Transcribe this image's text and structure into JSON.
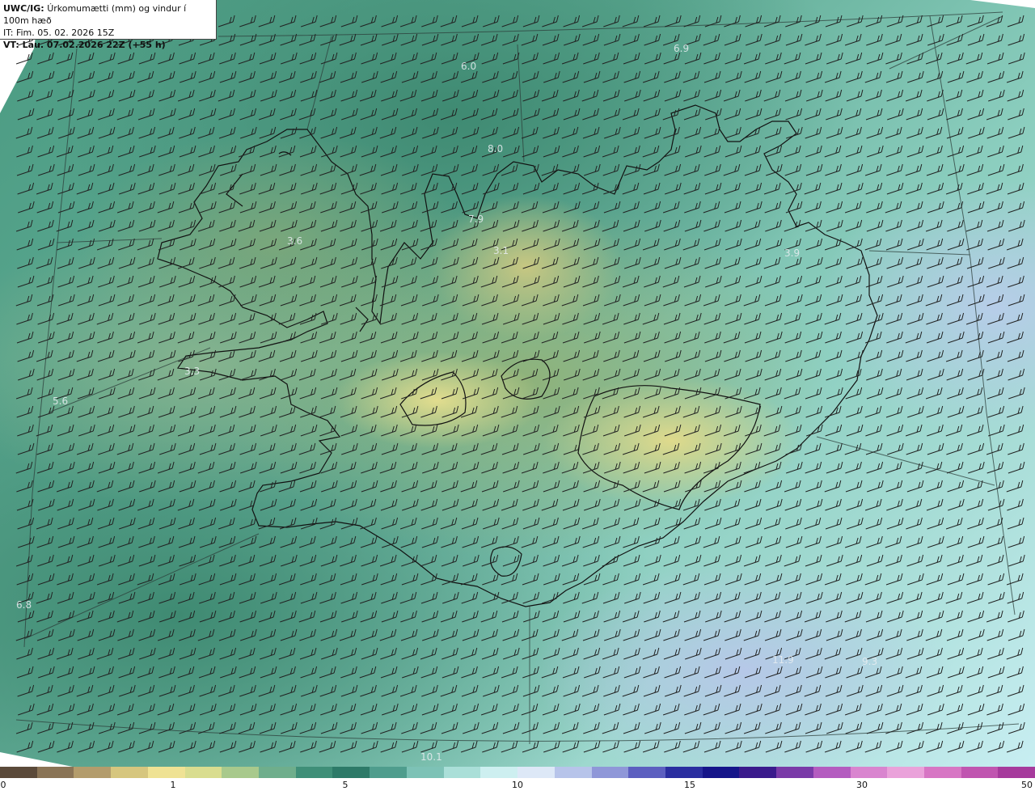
{
  "header": {
    "product_bold": "UWC/IG:",
    "product_title": "Úrkomumætti (mm) og vindur í 100m hæð",
    "init_time": "IT: Fim. 05. 02. 2026 15Z",
    "valid_time": "VT: Lau. 07.02.2026 22Z (+55 h)"
  },
  "map_labels": [
    {
      "text": "6.0",
      "name": "value-label-north"
    },
    {
      "text": "6.9",
      "name": "value-label-northeast-sea"
    },
    {
      "text": "8.0",
      "name": "value-label-north-sea"
    },
    {
      "text": "7.9",
      "name": "value-label-north-coast"
    },
    {
      "text": "3.6",
      "name": "value-label-westfjords"
    },
    {
      "text": "3.1",
      "name": "value-label-tröllaskagi"
    },
    {
      "text": "3.9",
      "name": "value-label-east"
    },
    {
      "text": "3.3",
      "name": "value-label-snaefellsnes"
    },
    {
      "text": "5.6",
      "name": "value-label-west-sea"
    },
    {
      "text": "6.8",
      "name": "value-label-southwest-sea"
    },
    {
      "text": "9.3",
      "name": "value-label-southeast-sea"
    },
    {
      "text": "11.9",
      "name": "value-label-south-sea"
    },
    {
      "text": "10.1",
      "name": "value-label-south-bottom"
    }
  ],
  "legend": {
    "ticks": [
      "0",
      "1",
      "5",
      "10",
      "15",
      "30",
      "50"
    ],
    "colors": [
      "#5b4a3a",
      "#8a7456",
      "#b39c6c",
      "#d6c67e",
      "#efe294",
      "#d9dd8f",
      "#a8c98c",
      "#6fae8c",
      "#3f8f78",
      "#2d7a68",
      "#4f9d8d",
      "#7dc2b6",
      "#aadfd8",
      "#cdeff0",
      "#dde8f7",
      "#b7c4ea",
      "#8f97d8",
      "#5c5fc0",
      "#2a2ea0",
      "#15158a",
      "#3a1a8c",
      "#7a3aa8",
      "#b45cc0",
      "#d985cf",
      "#eaa2da",
      "#d776c4",
      "#c055b0",
      "#a63a9c"
    ]
  }
}
